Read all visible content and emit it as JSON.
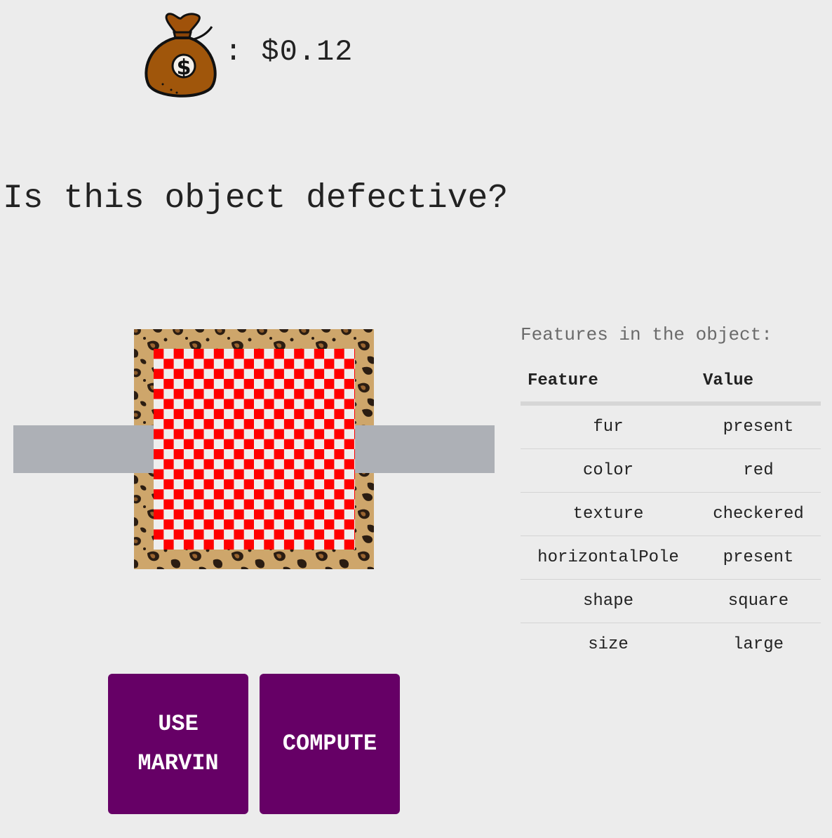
{
  "balance": {
    "icon": "money-bag-icon",
    "text": ": $0.12"
  },
  "question": "Is this object defective?",
  "object": {
    "fur": "leopard-pattern",
    "color": "#ff0000",
    "texture": "checkered",
    "pole_color": "#adb0b6"
  },
  "features": {
    "title": "Features in the object:",
    "headers": [
      "Feature",
      "Value"
    ],
    "rows": [
      {
        "feature": "fur",
        "value": "present"
      },
      {
        "feature": "color",
        "value": "red"
      },
      {
        "feature": "texture",
        "value": "checkered"
      },
      {
        "feature": "horizontalPole",
        "value": "present"
      },
      {
        "feature": "shape",
        "value": "square"
      },
      {
        "feature": "size",
        "value": "large"
      }
    ]
  },
  "buttons": {
    "marvin_line1": "USE",
    "marvin_line2": "MARVIN",
    "compute": "COMPUTE"
  },
  "colors": {
    "button_bg": "#660066",
    "background": "#ececec"
  }
}
